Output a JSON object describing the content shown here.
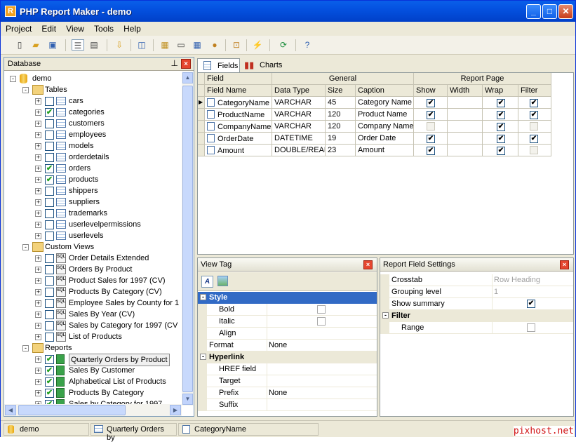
{
  "window": {
    "title": "PHP Report Maker - demo",
    "app_icon": "R"
  },
  "titlebar_buttons": {
    "minimize": "_",
    "maximize": "□",
    "close": "✕"
  },
  "menu": [
    "Project",
    "Edit",
    "View",
    "Tools",
    "Help"
  ],
  "toolbar_icons": [
    "new-icon",
    "open-icon",
    "save-icon",
    "tree-view-icon",
    "list-view-icon",
    "import-icon",
    "sync-icon",
    "report-icon",
    "page-icon",
    "table-icon",
    "color-icon",
    "lock-icon",
    "generate-icon",
    "refresh-icon",
    "help-icon"
  ],
  "database_pane": {
    "title": "Database",
    "root": "demo",
    "tables_label": "Tables",
    "tables": [
      {
        "name": "cars",
        "checked": false
      },
      {
        "name": "categories",
        "checked": true
      },
      {
        "name": "customers",
        "checked": false
      },
      {
        "name": "employees",
        "checked": false
      },
      {
        "name": "models",
        "checked": false
      },
      {
        "name": "orderdetails",
        "checked": false
      },
      {
        "name": "orders",
        "checked": true
      },
      {
        "name": "products",
        "checked": true
      },
      {
        "name": "shippers",
        "checked": false
      },
      {
        "name": "suppliers",
        "checked": false
      },
      {
        "name": "trademarks",
        "checked": false
      },
      {
        "name": "userlevelpermissions",
        "checked": false
      },
      {
        "name": "userlevels",
        "checked": false
      }
    ],
    "views_label": "Custom Views",
    "views": [
      {
        "name": "Order Details Extended",
        "checked": false
      },
      {
        "name": "Orders By Product",
        "checked": false
      },
      {
        "name": "Product Sales for 1997 (CV)",
        "checked": false
      },
      {
        "name": "Products By Category (CV)",
        "checked": false
      },
      {
        "name": "Employee Sales by County for 1",
        "checked": false
      },
      {
        "name": "Sales By Year (CV)",
        "checked": false
      },
      {
        "name": "Sales by Category for 1997 (CV",
        "checked": false
      },
      {
        "name": "List of Products",
        "checked": false
      }
    ],
    "reports_label": "Reports",
    "reports": [
      {
        "name": "Quarterly Orders by Product",
        "checked": true
      },
      {
        "name": "Sales By Customer",
        "checked": true
      },
      {
        "name": "Alphabetical List of Products",
        "checked": true
      },
      {
        "name": "Products By Category",
        "checked": true
      },
      {
        "name": "Sales by Category for 1997",
        "checked": true
      }
    ]
  },
  "tabs": {
    "fields": "Fields",
    "charts": "Charts"
  },
  "grid": {
    "group_field": "Field",
    "group_general": "General",
    "group_report_page": "Report Page",
    "columns": [
      "Field Name",
      "Data Type",
      "Size",
      "Caption",
      "Show",
      "Width",
      "Wrap",
      "Filter"
    ],
    "rows": [
      {
        "name": "CategoryName",
        "type": "VARCHAR",
        "size": "45",
        "caption": "Category Name",
        "show": true,
        "wrap": true,
        "filter": true,
        "filter_enabled": true
      },
      {
        "name": "ProductName",
        "type": "VARCHAR",
        "size": "120",
        "caption": "Product Name",
        "show": true,
        "wrap": true,
        "filter": true,
        "filter_enabled": true
      },
      {
        "name": "CompanyName",
        "type": "VARCHAR",
        "size": "120",
        "caption": "Company Name",
        "show": false,
        "wrap": true,
        "filter": false,
        "filter_enabled": false
      },
      {
        "name": "OrderDate",
        "type": "DATETIME",
        "size": "19",
        "caption": "Order Date",
        "show": true,
        "wrap": true,
        "filter": true,
        "filter_enabled": true
      },
      {
        "name": "Amount",
        "type": "DOUBLE/REAL",
        "size": "23",
        "caption": "Amount",
        "show": true,
        "wrap": true,
        "filter": false,
        "filter_enabled": false
      }
    ],
    "current_row_marker": "▶"
  },
  "view_tag": {
    "title": "View Tag",
    "sections": {
      "style": "Style",
      "hyperlink": "Hyperlink"
    },
    "props": {
      "bold": "Bold",
      "italic": "Italic",
      "align": "Align",
      "format": "Format",
      "format_value": "None",
      "href_field": "HREF field",
      "target": "Target",
      "prefix": "Prefix",
      "prefix_value": "None",
      "suffix": "Suffix"
    }
  },
  "field_settings": {
    "title": "Report Field Settings",
    "crosstab": "Crosstab",
    "crosstab_value": "Row Heading",
    "grouping_level": "Grouping level",
    "grouping_value": "1",
    "show_summary": "Show summary",
    "filter_section": "Filter",
    "range": "Range"
  },
  "statusbar": {
    "db": "demo",
    "report": "Quarterly Orders by",
    "field": "CategoryName"
  },
  "watermark": "pixhost.net",
  "colors": {
    "title_blue": "#0451e0",
    "selection": "#316ac5",
    "check_green": "#21a121"
  }
}
